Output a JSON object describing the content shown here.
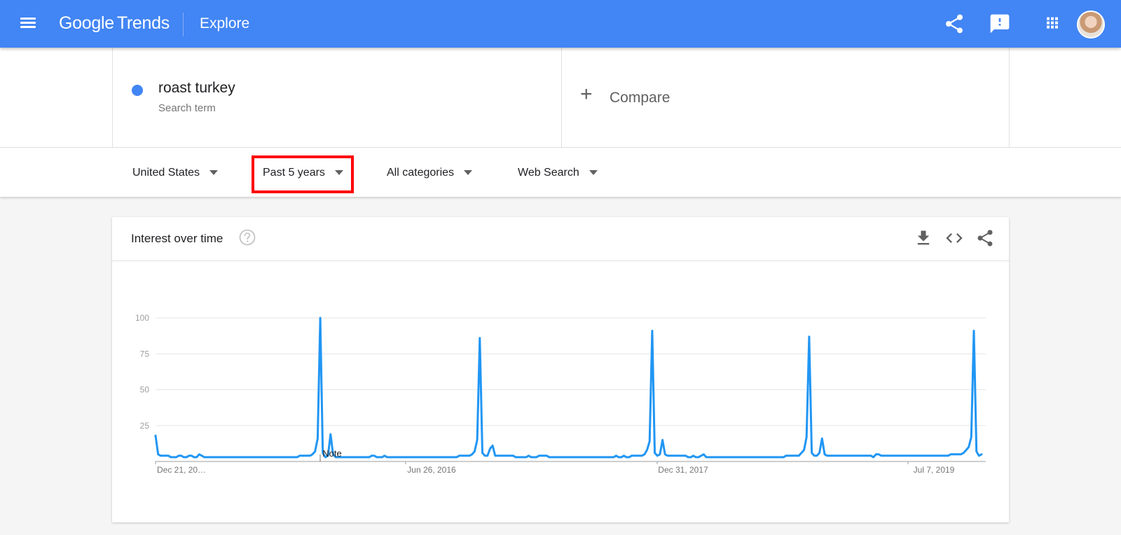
{
  "app": {
    "logo_google": "Google",
    "logo_trends": "Trends",
    "page": "Explore"
  },
  "header_icons": [
    "menu-icon",
    "share-icon",
    "feedback-icon",
    "apps-grid-icon",
    "avatar"
  ],
  "search": {
    "term": "roast turkey",
    "term_type": "Search term",
    "term_color": "#4285f4",
    "compare_plus": "+",
    "compare_label": "Compare"
  },
  "filters": {
    "region": "United States",
    "time": "Past 5 years",
    "category": "All categories",
    "property": "Web Search"
  },
  "card": {
    "title": "Interest over time",
    "icons": [
      "help-icon",
      "download-icon",
      "embed-icon",
      "share-icon"
    ]
  },
  "chart_data": {
    "type": "line",
    "title": "",
    "xlabel": "",
    "ylabel": "",
    "ylim": [
      0,
      100
    ],
    "y_ticks": [
      25,
      50,
      75,
      100
    ],
    "x_tick_labels": [
      "Dec 21, 20…",
      "Jun 26, 2016",
      "Dec 31, 2017",
      "Jul 7, 2019"
    ],
    "grid": true,
    "note_label": "Note",
    "series": [
      {
        "color": "#2196f3",
        "values": [
          18,
          5,
          4,
          4,
          4,
          4,
          3,
          3,
          3,
          4,
          4,
          3,
          3,
          4,
          4,
          3,
          3,
          5,
          4,
          3,
          3,
          3,
          3,
          3,
          3,
          3,
          3,
          3,
          3,
          3,
          3,
          3,
          3,
          3,
          3,
          3,
          3,
          3,
          3,
          3,
          3,
          3,
          3,
          3,
          3,
          3,
          3,
          3,
          3,
          3,
          3,
          3,
          3,
          3,
          3,
          3,
          4,
          4,
          4,
          4,
          4,
          5,
          7,
          16,
          100,
          6,
          3,
          4,
          19,
          5,
          3,
          3,
          3,
          3,
          3,
          3,
          3,
          3,
          3,
          3,
          3,
          3,
          3,
          3,
          4,
          4,
          3,
          3,
          3,
          4,
          3,
          3,
          3,
          3,
          3,
          3,
          3,
          3,
          3,
          3,
          3,
          3,
          3,
          3,
          3,
          3,
          3,
          3,
          3,
          3,
          3,
          3,
          3,
          3,
          3,
          3,
          3,
          3,
          4,
          4,
          4,
          4,
          4,
          5,
          7,
          15,
          86,
          6,
          4,
          4,
          9,
          11,
          4,
          4,
          4,
          4,
          4,
          4,
          4,
          4,
          3,
          3,
          3,
          3,
          3,
          4,
          3,
          3,
          3,
          4,
          4,
          4,
          4,
          3,
          3,
          3,
          3,
          3,
          3,
          3,
          3,
          3,
          3,
          3,
          3,
          3,
          3,
          3,
          3,
          3,
          3,
          3,
          3,
          3,
          3,
          3,
          3,
          3,
          3,
          4,
          3,
          3,
          4,
          3,
          3,
          4,
          4,
          4,
          4,
          4,
          5,
          8,
          14,
          91,
          6,
          4,
          5,
          15,
          5,
          4,
          4,
          4,
          4,
          4,
          4,
          4,
          4,
          3,
          3,
          4,
          3,
          3,
          4,
          5,
          3,
          3,
          3,
          3,
          3,
          3,
          3,
          3,
          3,
          3,
          3,
          3,
          3,
          3,
          3,
          3,
          3,
          3,
          3,
          3,
          3,
          3,
          3,
          3,
          3,
          3,
          3,
          3,
          3,
          3,
          3,
          4,
          4,
          4,
          4,
          4,
          4,
          6,
          8,
          17,
          87,
          6,
          4,
          4,
          6,
          16,
          5,
          4,
          4,
          4,
          4,
          4,
          4,
          4,
          4,
          4,
          4,
          4,
          4,
          4,
          4,
          4,
          4,
          4,
          4,
          3,
          5,
          5,
          4,
          4,
          4,
          4,
          4,
          4,
          4,
          4,
          4,
          4,
          4,
          4,
          4,
          4,
          4,
          4,
          4,
          4,
          4,
          4,
          4,
          4,
          4,
          4,
          4,
          4,
          4,
          5,
          5,
          5,
          5,
          5,
          6,
          8,
          10,
          17,
          91,
          7,
          4,
          5
        ]
      }
    ]
  }
}
